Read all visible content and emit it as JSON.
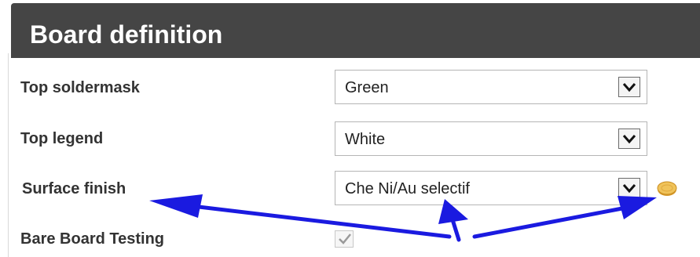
{
  "header": {
    "title": "Board definition"
  },
  "rows": {
    "top_soldermask": {
      "label": "Top soldermask",
      "value": "Green"
    },
    "top_legend": {
      "label": "Top legend",
      "value": "White"
    },
    "surface_finish": {
      "label": "Surface finish",
      "value": "Che Ni/Au selectif"
    },
    "bare_board_testing": {
      "label": "Bare Board Testing",
      "checked": true
    }
  },
  "icons": {
    "dropdown": "chevron-down-icon",
    "info": "coin-icon",
    "check": "check-icon"
  },
  "colors": {
    "header_bg": "#454545",
    "annotation_arrow": "#1a1ae0",
    "coin": "#e8b84a"
  }
}
